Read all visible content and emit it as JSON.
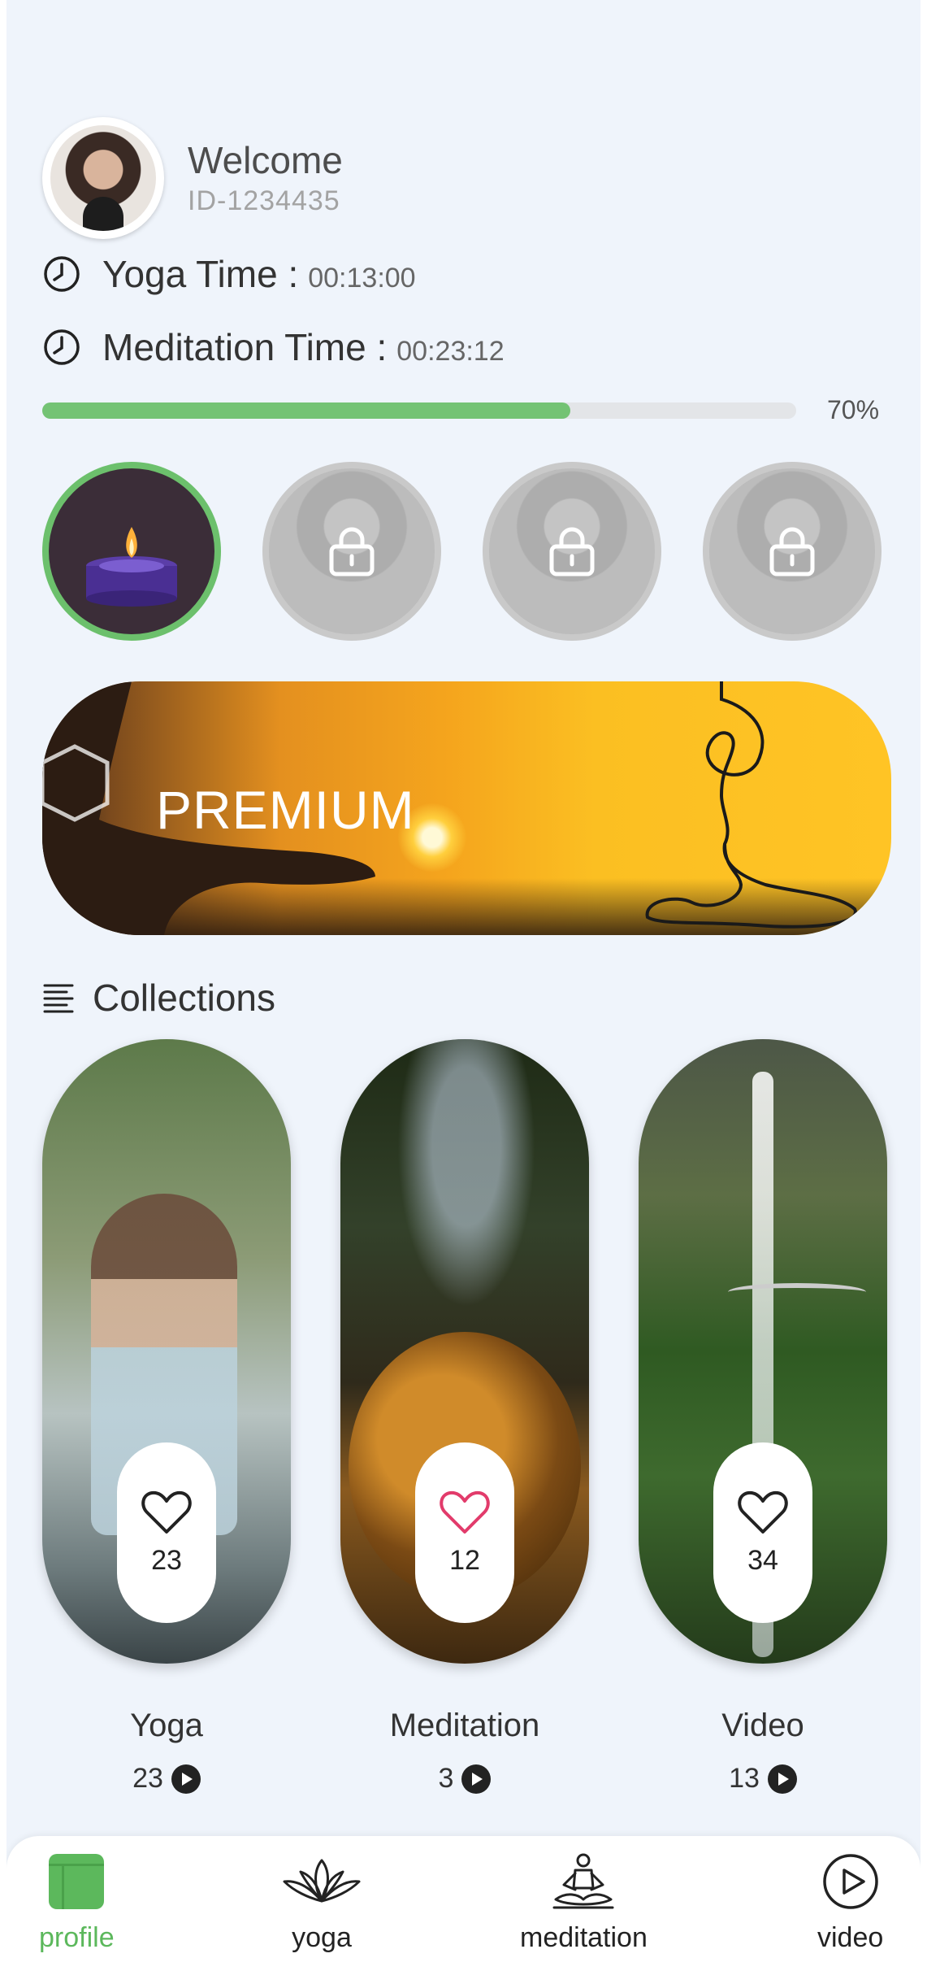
{
  "user": {
    "welcome": "Welcome",
    "id": "ID-1234435"
  },
  "stats": {
    "yoga_label": "Yoga Time :",
    "yoga_value": "00:13:00",
    "meditation_label": "Meditation Time :",
    "meditation_value": "00:23:12"
  },
  "progress": {
    "percent_text": "70%",
    "fraction": 0.7,
    "color": "#74c374"
  },
  "levels": [
    {
      "state": "unlocked",
      "icon": "candle-icon"
    },
    {
      "state": "locked",
      "icon": "lock-icon"
    },
    {
      "state": "locked",
      "icon": "lock-icon"
    },
    {
      "state": "locked",
      "icon": "lock-icon"
    }
  ],
  "premium": {
    "label": "PREMIUM"
  },
  "collections": {
    "heading": "Collections",
    "cards": [
      {
        "title": "Yoga",
        "likes": "23",
        "count": "23",
        "heart_color": "#222222"
      },
      {
        "title": "Meditation",
        "likes": "12",
        "count": "3",
        "heart_color": "#e23b6b"
      },
      {
        "title": "Video",
        "likes": "34",
        "count": "13",
        "heart_color": "#222222"
      }
    ]
  },
  "nav": {
    "items": [
      {
        "label": "profile",
        "icon": "profile-icon",
        "active": true
      },
      {
        "label": "yoga",
        "icon": "lotus-icon",
        "active": false
      },
      {
        "label": "meditation",
        "icon": "meditation-icon",
        "active": false
      },
      {
        "label": "video",
        "icon": "play-circle-icon",
        "active": false
      }
    ],
    "active_color": "#5cb85c"
  }
}
